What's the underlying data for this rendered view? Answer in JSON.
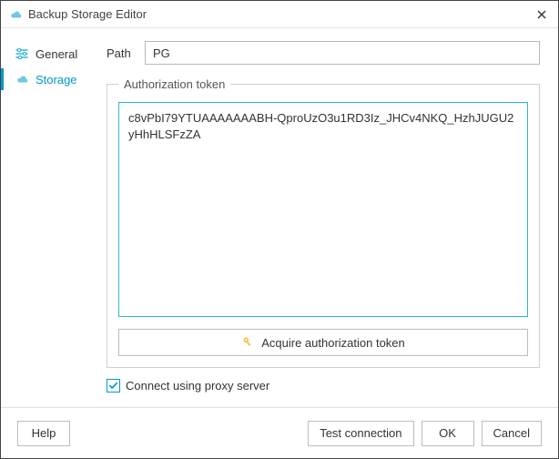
{
  "window": {
    "title": "Backup Storage Editor"
  },
  "sidebar": {
    "items": [
      {
        "label": "General"
      },
      {
        "label": "Storage"
      }
    ]
  },
  "content": {
    "path_label": "Path",
    "path_value": "PG",
    "auth_legend": "Authorization token",
    "token_value": "c8vPbI79YTUAAAAAAABH-QproUzO3u1RD3Iz_JHCv4NKQ_HzhJUGU2yHhHLSFzZA",
    "acquire_label": "Acquire authorization token",
    "proxy_label": "Connect using proxy server",
    "proxy_checked": true
  },
  "footer": {
    "help": "Help",
    "test": "Test connection",
    "ok": "OK",
    "cancel": "Cancel"
  }
}
